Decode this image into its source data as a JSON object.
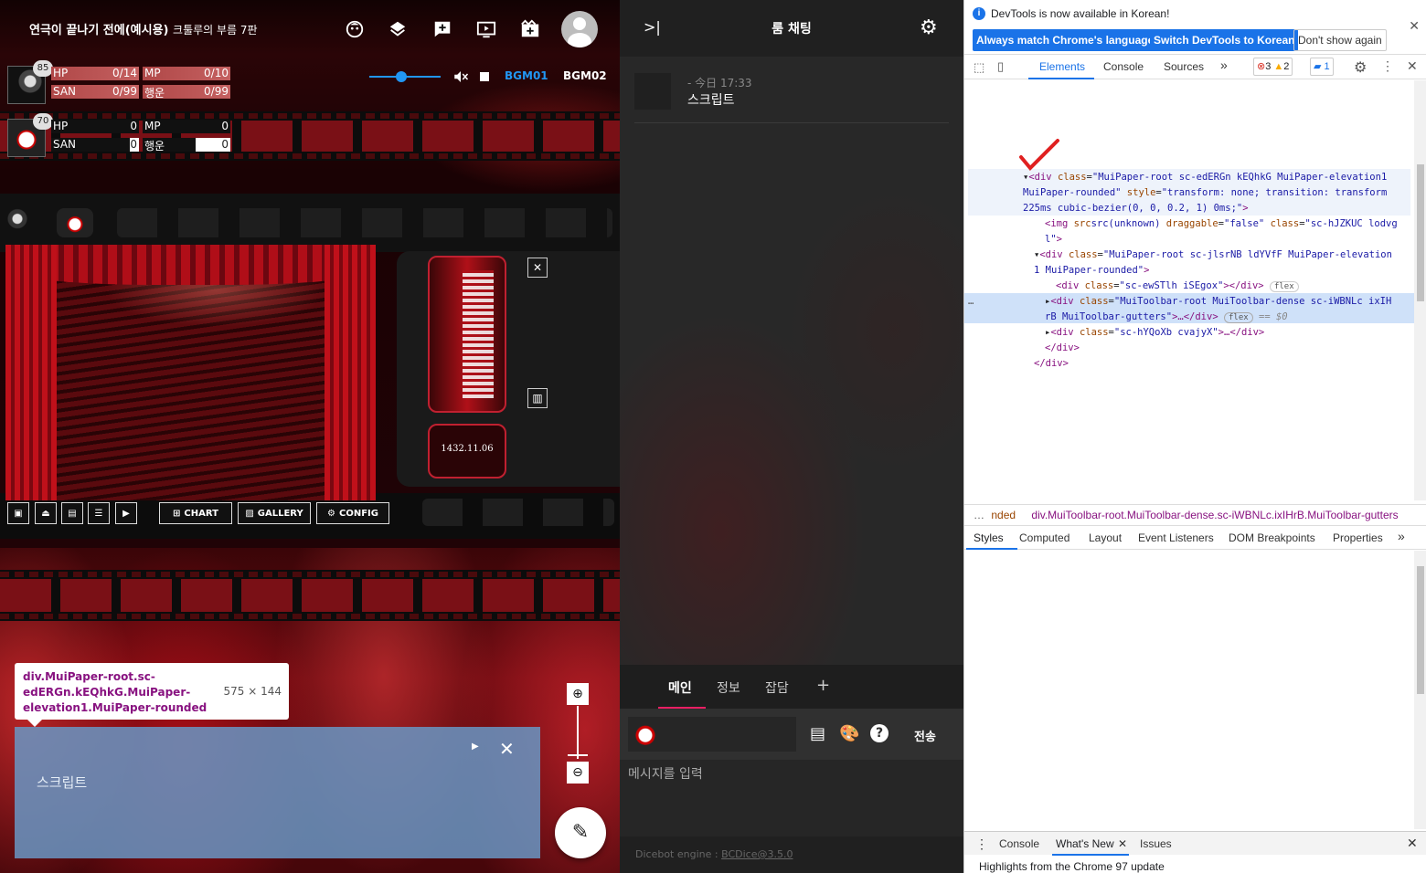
{
  "board": {
    "title_main": "연극이 끝나기 전에(예시용)",
    "title_sub": "크툴루의 부름 7판",
    "toolbar_icons": [
      "face-icon",
      "layers-icon",
      "add-box-icon",
      "slideshow-icon",
      "movie-icon",
      "account-icon"
    ],
    "characters": [
      {
        "badge": "85",
        "hp_label": "HP",
        "hp": "0/14",
        "mp_label": "MP",
        "mp": "0/10",
        "san_label": "SAN",
        "san": "0/99",
        "luck_label": "행운",
        "luck": "0/99"
      },
      {
        "badge": "70",
        "hp_label": "HP",
        "hp": "0",
        "mp_label": "MP",
        "mp": "0",
        "san_label": "SAN",
        "san": "0",
        "luck_label": "행운",
        "luck": "0"
      }
    ],
    "volume_level": 0.45,
    "bgm": [
      {
        "label": "BGM01",
        "color": "#2196f3"
      },
      {
        "label": "BGM02",
        "color": "#ffffff"
      }
    ],
    "ticket_date": "1432.11.06",
    "menu": {
      "chart": "CHART",
      "gallery": "GALLERY",
      "config": "CONFIG"
    },
    "inspect_tooltip": {
      "selector": "div.MuiPaper-root.sc-edERGn.kEQhkG.MuiPaper-elevation1.MuiPaper-rounded",
      "size": "575 × 144"
    },
    "script_box": {
      "text": "스크립트"
    }
  },
  "chat": {
    "title": "룸 채팅",
    "messages": [
      {
        "meta": "- 今日 17:33",
        "text": "스크립트"
      }
    ],
    "tabs": [
      "메인",
      "정보",
      "잡담"
    ],
    "add_tab": "+",
    "send": "전송",
    "placeholder": "메시지를 입력",
    "footer_prefix": "Dicebot engine : ",
    "footer_link": "BCDice@3.5.0"
  },
  "devtools": {
    "info_text": "DevTools is now available in Korean!",
    "btn_match": "Always match Chrome's language",
    "btn_switch": "Switch DevTools to Korean",
    "btn_dont": "Don't show again",
    "tabs": [
      "Elements",
      "Console",
      "Sources"
    ],
    "more": "»",
    "errors": "3",
    "warnings": "2",
    "messages": "1",
    "dom_lines": [
      "\"MuiPaper-root sc-edERGn kEQhkG MuiPaper-elevation1",
      "MuiPaper-rounded\"",
      "\"transform: none; transition: transform",
      "225ms cubic-bezier(0, 0, 0.2, 1) 0ms;\"",
      "src(unknown)",
      "\"false\"",
      "\"sc-hJZKUC lodvg",
      "l\"",
      "\"MuiPaper-root sc-jlsrNB ldYVfF MuiPaper-elevation",
      "1 MuiPaper-rounded\"",
      "\"sc-ewSTlh iSEgox\"",
      "flex",
      "\"MuiToolbar-root MuiToolbar-dense sc-iWBNLc ixIH",
      "rB MuiToolbar-gutters\"",
      "== $0",
      "\"sc-hYQoXb cvajyX\""
    ],
    "breadcrumb_prefix": "nded",
    "breadcrumb": "div.MuiToolbar-root.MuiToolbar-dense.sc-iWBNLc.ixIHrB.MuiToolbar-gutters",
    "style_tabs": [
      "Styles",
      "Computed",
      "Layout",
      "Event Listeners",
      "DOM Breakpoints",
      "Properties"
    ],
    "drawer_tabs": [
      "Console",
      "What's New",
      "Issues"
    ],
    "whats_new": "Highlights from the Chrome 97 update"
  }
}
